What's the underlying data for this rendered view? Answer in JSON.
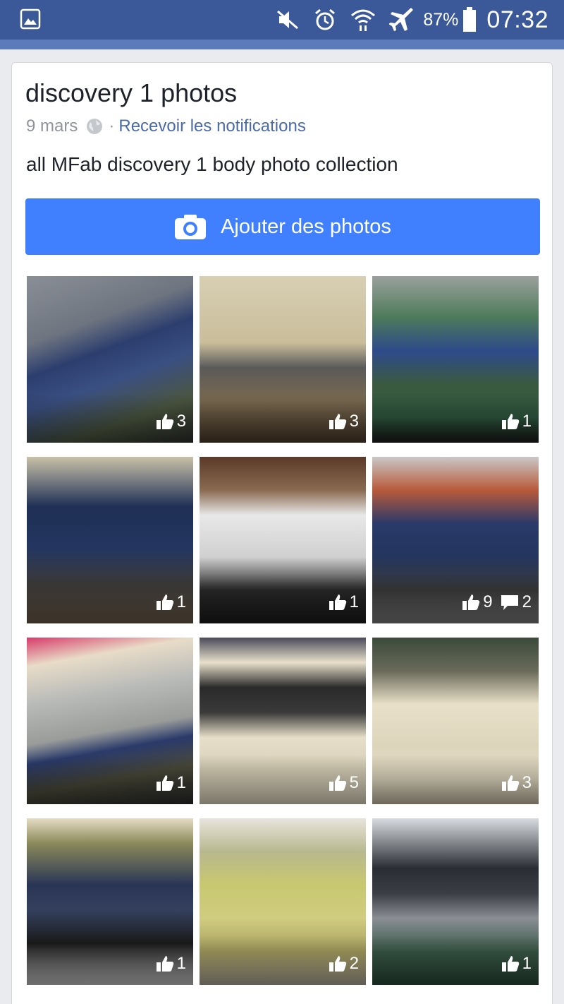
{
  "status_bar": {
    "battery": "87%",
    "time": "07:32",
    "icons": [
      "gallery-icon",
      "mute-icon",
      "alarm-icon",
      "wifi-icon",
      "airplane-mode-icon",
      "battery-icon"
    ]
  },
  "album": {
    "title": "discovery 1 photos",
    "date": "9 mars",
    "separator": "·",
    "notifications_link": "Recevoir les notifications",
    "description": "all MFab discovery 1 body photo collection",
    "add_photos_label": "Ajouter des photos"
  },
  "colors": {
    "header": "#3b5998",
    "button": "#4080ff",
    "link": "#4b6aa8"
  },
  "photos": [
    {
      "likes": "3",
      "comments": ""
    },
    {
      "likes": "3",
      "comments": ""
    },
    {
      "likes": "1",
      "comments": ""
    },
    {
      "likes": "1",
      "comments": ""
    },
    {
      "likes": "1",
      "comments": ""
    },
    {
      "likes": "9",
      "comments": "2"
    },
    {
      "likes": "1",
      "comments": ""
    },
    {
      "likes": "5",
      "comments": ""
    },
    {
      "likes": "3",
      "comments": ""
    },
    {
      "likes": "1",
      "comments": ""
    },
    {
      "likes": "2",
      "comments": ""
    },
    {
      "likes": "1",
      "comments": ""
    }
  ]
}
